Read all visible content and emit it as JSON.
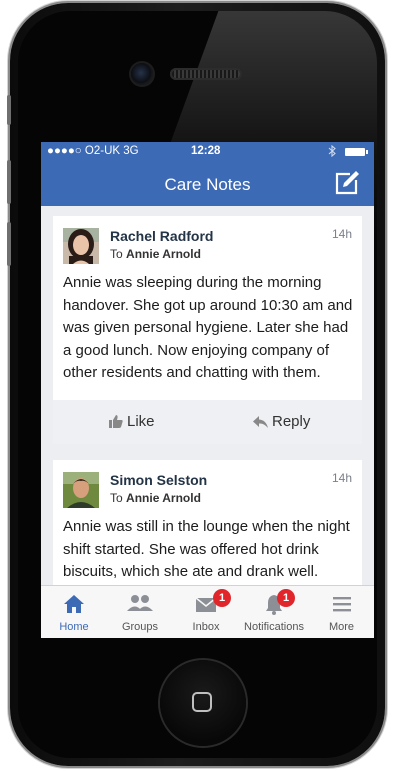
{
  "status_bar": {
    "carrier": "●●●●○ O2-UK  3G",
    "time": "12:28",
    "bluetooth": "bluetooth-icon",
    "battery": "battery-icon"
  },
  "header": {
    "title": "Care Notes",
    "compose_icon": "compose-icon"
  },
  "posts": [
    {
      "author": "Rachel Radford",
      "to_prefix": "To",
      "to_name": "Annie Arnold",
      "time": "14h",
      "body": "Annie was sleeping during the morning handover. She got up around 10:30 am and was given personal hygiene. Later she had a good lunch. Now enjoying company of other residents and chatting with them.",
      "like_label": "Like",
      "reply_label": "Reply"
    },
    {
      "author": "Simon Selston",
      "to_prefix": "To",
      "to_name": "Annie Arnold",
      "time": "14h",
      "body": "Annie was still in the lounge when the night shift started. She was offered hot drink biscuits, which she ate and drank well. Supported her to bed and she"
    }
  ],
  "tabs": [
    {
      "label": "Home",
      "icon": "home-icon",
      "active": true
    },
    {
      "label": "Groups",
      "icon": "groups-icon"
    },
    {
      "label": "Inbox",
      "icon": "inbox-icon",
      "badge": "1"
    },
    {
      "label": "Notifications",
      "icon": "bell-icon",
      "badge": "1"
    },
    {
      "label": "More",
      "icon": "menu-icon"
    }
  ],
  "colors": {
    "accent": "#3d6ab5",
    "badge": "#e0262b",
    "card_bg": "#ffffff",
    "feed_bg": "#eceef2"
  }
}
